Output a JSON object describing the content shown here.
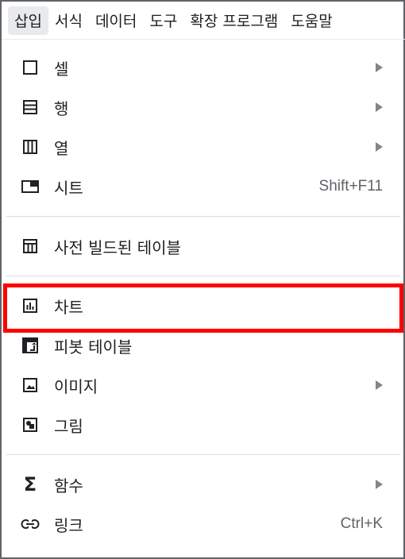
{
  "menubar": {
    "items": [
      "삽입",
      "서식",
      "데이터",
      "도구",
      "확장 프로그램",
      "도움말"
    ]
  },
  "menu": {
    "group1": [
      {
        "label": "셀",
        "icon": "cell-icon",
        "submenu": true
      },
      {
        "label": "행",
        "icon": "row-icon",
        "submenu": true
      },
      {
        "label": "열",
        "icon": "column-icon",
        "submenu": true
      },
      {
        "label": "시트",
        "icon": "sheet-icon",
        "shortcut": "Shift+F11"
      }
    ],
    "group2": [
      {
        "label": "사전 빌드된 테이블",
        "icon": "table-icon"
      }
    ],
    "group3": [
      {
        "label": "차트",
        "icon": "chart-icon"
      },
      {
        "label": "피봇 테이블",
        "icon": "pivot-table-icon"
      },
      {
        "label": "이미지",
        "icon": "image-icon",
        "submenu": true
      },
      {
        "label": "그림",
        "icon": "drawing-icon"
      }
    ],
    "group4": [
      {
        "label": "함수",
        "icon": "sigma-icon",
        "submenu": true
      },
      {
        "label": "링크",
        "icon": "link-icon",
        "shortcut": "Ctrl+K"
      }
    ]
  },
  "highlight_color": "#ff0000"
}
